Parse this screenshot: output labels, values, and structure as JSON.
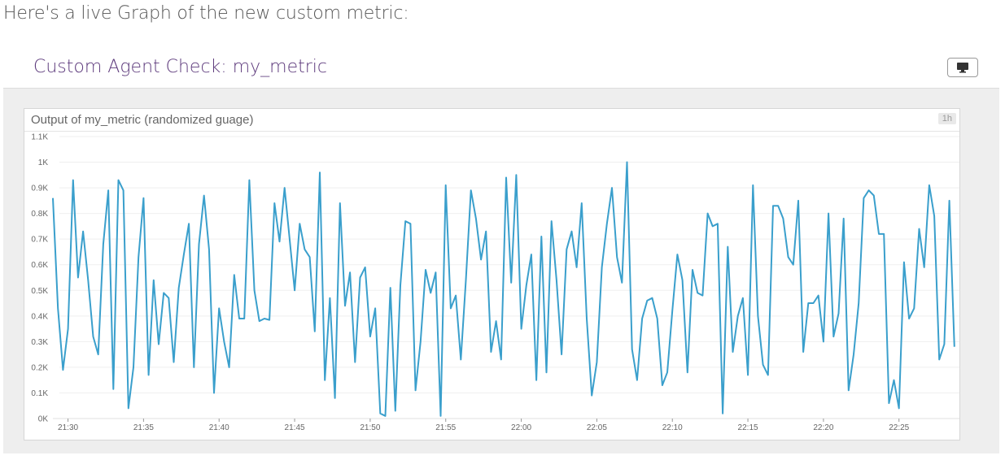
{
  "intro_text": "Here's a live Graph of the new custom metric:",
  "panel": {
    "title": "Custom Agent Check: my_metric",
    "tv_button_icon": "monitor-icon"
  },
  "colors": {
    "title": "#5d3a7c",
    "series": "#3a9fcc",
    "panel_bg": "#eeeeee"
  },
  "chart_data": {
    "type": "line",
    "title": "Output of my_metric (randomized guage)",
    "time_range_label": "1h",
    "xlabel": "",
    "ylabel": "",
    "grid": true,
    "legend": "none",
    "ylim": [
      0,
      1100
    ],
    "yticks": [
      {
        "value": 0,
        "label": "0K"
      },
      {
        "value": 100,
        "label": "0.1K"
      },
      {
        "value": 200,
        "label": "0.2K"
      },
      {
        "value": 300,
        "label": "0.3K"
      },
      {
        "value": 400,
        "label": "0.4K"
      },
      {
        "value": 500,
        "label": "0.5K"
      },
      {
        "value": 600,
        "label": "0.6K"
      },
      {
        "value": 700,
        "label": "0.7K"
      },
      {
        "value": 800,
        "label": "0.8K"
      },
      {
        "value": 900,
        "label": "0.9K"
      },
      {
        "value": 1000,
        "label": "1K"
      },
      {
        "value": 1100,
        "label": "1.1K"
      }
    ],
    "xlim": [
      "21:29",
      "22:29"
    ],
    "xticks": [
      "21:30",
      "21:35",
      "21:40",
      "21:45",
      "21:50",
      "21:55",
      "22:00",
      "22:05",
      "22:10",
      "22:15",
      "22:20",
      "22:25"
    ],
    "series": [
      {
        "x_start": "21:29",
        "interval_seconds": 20,
        "values": [
          860,
          430,
          190,
          350,
          930,
          550,
          730,
          540,
          320,
          250,
          680,
          890,
          115,
          930,
          890,
          40,
          200,
          630,
          860,
          170,
          540,
          290,
          490,
          470,
          220,
          510,
          640,
          760,
          200,
          680,
          870,
          660,
          100,
          430,
          300,
          200,
          560,
          390,
          390,
          930,
          500,
          380,
          390,
          385,
          840,
          690,
          900,
          700,
          500,
          760,
          660,
          630,
          340,
          960,
          150,
          470,
          80,
          840,
          440,
          570,
          220,
          550,
          590,
          320,
          430,
          20,
          10,
          510,
          30,
          520,
          770,
          760,
          110,
          300,
          580,
          490,
          570,
          10,
          910,
          430,
          480,
          230,
          540,
          890,
          780,
          620,
          730,
          260,
          380,
          230,
          940,
          530,
          950,
          350,
          520,
          640,
          150,
          710,
          180,
          770,
          540,
          250,
          660,
          730,
          590,
          840,
          390,
          90,
          220,
          590,
          760,
          900,
          630,
          530,
          1000,
          270,
          150,
          390,
          460,
          470,
          390,
          130,
          180,
          420,
          640,
          540,
          180,
          580,
          490,
          480,
          800,
          750,
          760,
          20,
          670,
          260,
          400,
          470,
          170,
          910,
          400,
          210,
          170,
          830,
          830,
          780,
          630,
          600,
          850,
          260,
          450,
          450,
          480,
          300,
          800,
          320,
          410,
          780,
          110,
          250,
          450,
          860,
          890,
          870,
          720,
          720,
          60,
          150,
          40,
          610,
          390,
          430,
          740,
          590,
          910,
          790,
          230,
          290,
          850,
          280
        ]
      }
    ]
  }
}
